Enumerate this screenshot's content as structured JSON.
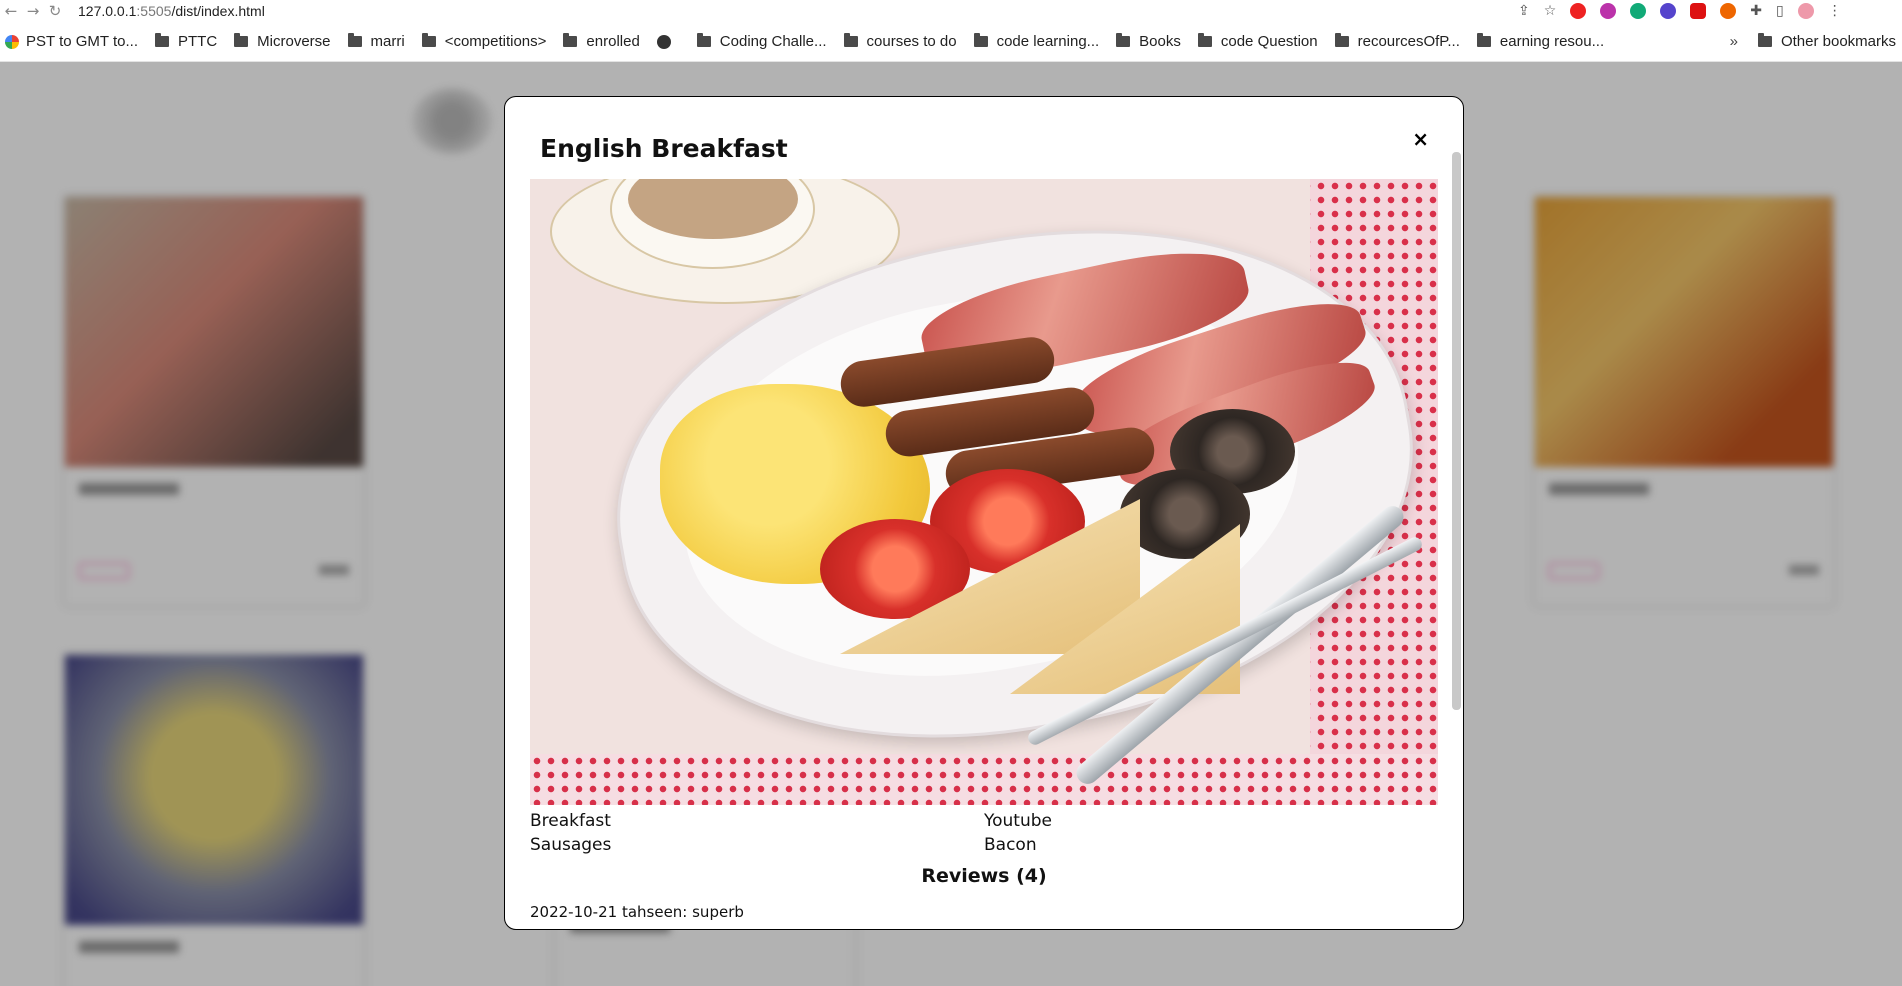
{
  "browser": {
    "url_host": "127.0.0.1",
    "url_port": ":5505",
    "url_path": "/dist/index.html",
    "bookmarks": [
      "PST to GMT to...",
      "PTTC",
      "Microverse",
      "marri",
      "<competitions>",
      "enrolled",
      "Coding Challe...",
      "courses to do",
      "code learning...",
      "Books",
      "code Question",
      "recourcesOfP...",
      "earning resou..."
    ],
    "overflow_chevron": "»",
    "other_bookmarks": "Other bookmarks"
  },
  "modal": {
    "title": "English Breakfast",
    "close_label": "×",
    "category": "Breakfast",
    "source": "Youtube",
    "ingredient_1": "Sausages",
    "ingredient_2": "Bacon",
    "reviews_heading": "Reviews (4)",
    "review_1": "2022-10-21 tahseen: superb"
  }
}
